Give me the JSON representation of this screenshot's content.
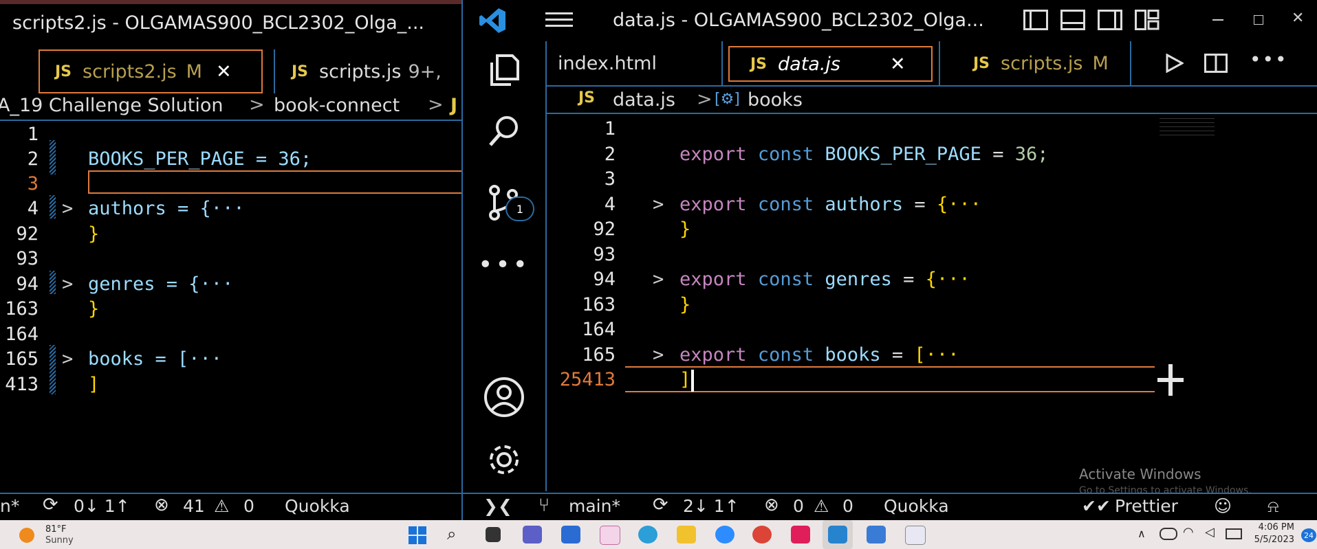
{
  "left": {
    "title": "scripts2.js - OLGAMAS900_BCL2302_Olga_...",
    "tabs": [
      {
        "icon": "JS",
        "label": "scripts2.js",
        "badge": "M",
        "close": "✕"
      },
      {
        "icon": "JS",
        "label": "scripts.js",
        "badge": "9+,"
      }
    ],
    "breadcrumb": [
      "A_19 Challenge Solution",
      "book-connect",
      "J"
    ],
    "lines": [
      {
        "num": "1",
        "code": ""
      },
      {
        "num": "2",
        "code": "BOOKS_PER_PAGE = 36;"
      },
      {
        "num": "3",
        "code": ""
      },
      {
        "num": "4",
        "code": "authors = {···"
      },
      {
        "num": "92",
        "code": "}"
      },
      {
        "num": "93",
        "code": ""
      },
      {
        "num": "94",
        "code": "genres = {···"
      },
      {
        "num": "163",
        "code": "}"
      },
      {
        "num": "164",
        "code": ""
      },
      {
        "num": "165",
        "code": "books = [···"
      },
      {
        "num": "413",
        "code": "]"
      }
    ],
    "status": {
      "branch": "n*",
      "sync": "0↓ 1↑",
      "errors": "41",
      "warnings": "0",
      "ext": "Quokka"
    }
  },
  "right": {
    "title": "data.js - OLGAMAS900_BCL2302_Olga...",
    "tabs": [
      {
        "label": "index.html"
      },
      {
        "icon": "JS",
        "label": "data.js",
        "close": "✕"
      },
      {
        "icon": "JS",
        "label": "scripts.js",
        "badge": "M"
      }
    ],
    "breadcrumb": {
      "file": "data.js",
      "symbol": "books"
    },
    "lines": [
      {
        "num": "1"
      },
      {
        "num": "2",
        "kw": "export",
        "kw2": "const",
        "id": "BOOKS_PER_PAGE",
        "rest": " = ",
        "val": "36;"
      },
      {
        "num": "3"
      },
      {
        "num": "4",
        "kw": "export",
        "kw2": "const",
        "id": "authors",
        "rest": " = ",
        "val": "{···"
      },
      {
        "num": "92",
        "val": "}"
      },
      {
        "num": "93"
      },
      {
        "num": "94",
        "kw": "export",
        "kw2": "const",
        "id": "genres",
        "rest": " = ",
        "val": "{···"
      },
      {
        "num": "163",
        "val": "}"
      },
      {
        "num": "164"
      },
      {
        "num": "165",
        "kw": "export",
        "kw2": "const",
        "id": "books",
        "rest": " = ",
        "val": "[···"
      },
      {
        "num": "25413",
        "val": "]"
      }
    ],
    "source_control_badge": "1",
    "watermark": {
      "line1": "Activate Windows",
      "line2": "Go to Settings to activate Windows."
    },
    "status": {
      "branch": "main*",
      "sync": "2↓ 1↑",
      "errors": "0",
      "warnings": "0",
      "ext": "Quokka",
      "formatter": "Prettier"
    }
  },
  "taskbar": {
    "temp": "81°F",
    "weather": "Sunny",
    "time": "4:06 PM",
    "date": "5/5/2023",
    "notif": "24"
  },
  "colors": {
    "accent": "#2a6aa0",
    "activeTab": "#e07a3a",
    "lineNumActive": "#e07a3a"
  }
}
